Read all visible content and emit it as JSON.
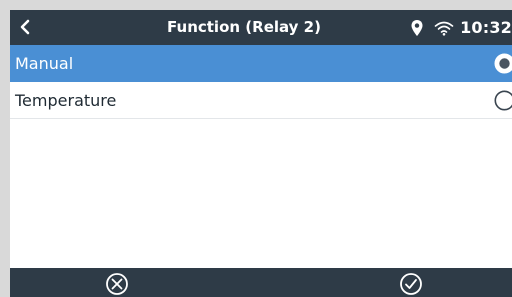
{
  "header": {
    "back_icon": "chevron-left-icon",
    "title": "Function (Relay 2)",
    "time": "10:32",
    "status_icons": [
      "location-pin-icon",
      "wifi-icon"
    ]
  },
  "options": [
    {
      "label": "Manual",
      "selected": true
    },
    {
      "label": "Temperature",
      "selected": false
    }
  ],
  "footer": {
    "cancel_icon": "circle-x-icon",
    "confirm_icon": "circle-check-icon"
  },
  "colors": {
    "bar": "#2e3b47",
    "selected_row": "#4a8fd4",
    "background": "#ffffff"
  }
}
